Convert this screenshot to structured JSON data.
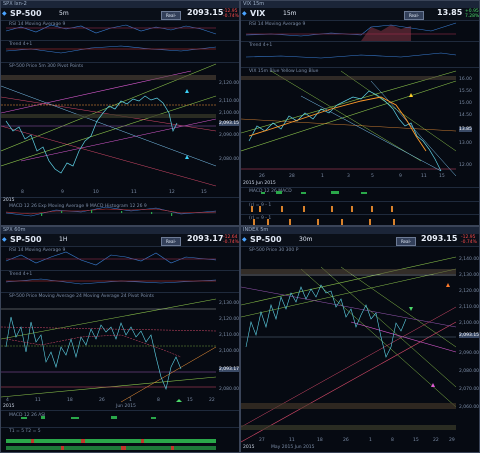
{
  "panels": {
    "tl": {
      "title": "SPX Ixn-2",
      "symbol": "SP-500",
      "tf": "5m",
      "rt": "Real-Time",
      "price": "2093.15",
      "chg1": "-12.95",
      "chg2": "-0.74%",
      "ind1": "RSI 14 Moving Average 9",
      "ind2": "Trend 4+1",
      "main": "SP-500 Price  5m  300  Pivot Points",
      "ind3": "MACD 12 26  Exp Moving Average 9  MACD Histogram 12 26 9",
      "xlab": [
        "8",
        "9",
        "10",
        "11",
        "12",
        "15"
      ],
      "ylab": [
        "2,120.00",
        "2,110.00",
        "2,100.00",
        "2,093.15",
        "2,090.00",
        "2,080.00"
      ],
      "foot": "2015"
    },
    "tr": {
      "title": "VIX 15m",
      "symbol": "VIX",
      "tf": "15m",
      "rt": "Real-Time",
      "price": "13.85",
      "chg1": "+0.95",
      "chg2": "7.28%",
      "ind1": "RSI 14 Moving Average 9",
      "ind2": "Trend 4+1",
      "main": "VIX  15m  Blue  Yellow  Long Blue",
      "ind3": "MACD 12 26  MACD",
      "ind4": "(r) = 9 - 1",
      "ind5": "(r) = 9 - 1",
      "xlab": [
        "26",
        "27",
        "28",
        "29",
        "1",
        "2",
        "3",
        "4",
        "5",
        "8",
        "9",
        "10",
        "11",
        "12",
        "15",
        "16",
        "17"
      ],
      "ylab": [
        "16.00",
        "15.50",
        "15.00",
        "14.50",
        "14.00",
        "13.85",
        "13.00",
        "12.50",
        "12.00"
      ],
      "foot": "2015 Jun 2015"
    },
    "bl": {
      "title": "SPX 60m",
      "symbol": "SP-500",
      "tf": "1H",
      "rt": "Real-Time",
      "price": "2093.17",
      "chg1": "-12.64",
      "chg2": "-0.74%",
      "ind1": "RSI 14 Moving Average 9",
      "ind2": "Trend 4+1",
      "main": "SP-500 Price  Moving Average 24  Moving Average 24  Pivot Points",
      "ind3": "MACD 12 26  ASI",
      "ind4": "T1 = 5  T2 = 5",
      "xlab": [
        "4",
        "11",
        "18",
        "26",
        "1",
        "8",
        "15",
        "22"
      ],
      "ylab": [
        "2,130.00",
        "2,120.00",
        "2,110.00",
        "2,100.00",
        "2,093.17",
        "2,090.00",
        "2,080.00"
      ],
      "foot": "2015",
      "month": "Jun 2015"
    },
    "br": {
      "title": "INDEX 5m",
      "symbol": "SP-500",
      "tf": "30m",
      "rt": "Real-Time",
      "price": "2093.15",
      "chg1": "-12.95",
      "chg2": "-0.74%",
      "main": "SP-500 Price  30  300  P",
      "xlab": [
        "27",
        "11",
        "18",
        "26",
        "1",
        "8",
        "15",
        "22",
        "29"
      ],
      "ylab": [
        "2,140.00",
        "2,130.00",
        "2,120.00",
        "2,110.00",
        "2,100.00",
        "2,093.15",
        "2,090.00",
        "2,080.00",
        "2,070.00",
        "2,060.00"
      ],
      "foot": "2015",
      "month": "May 2015    Jun 2015"
    }
  }
}
